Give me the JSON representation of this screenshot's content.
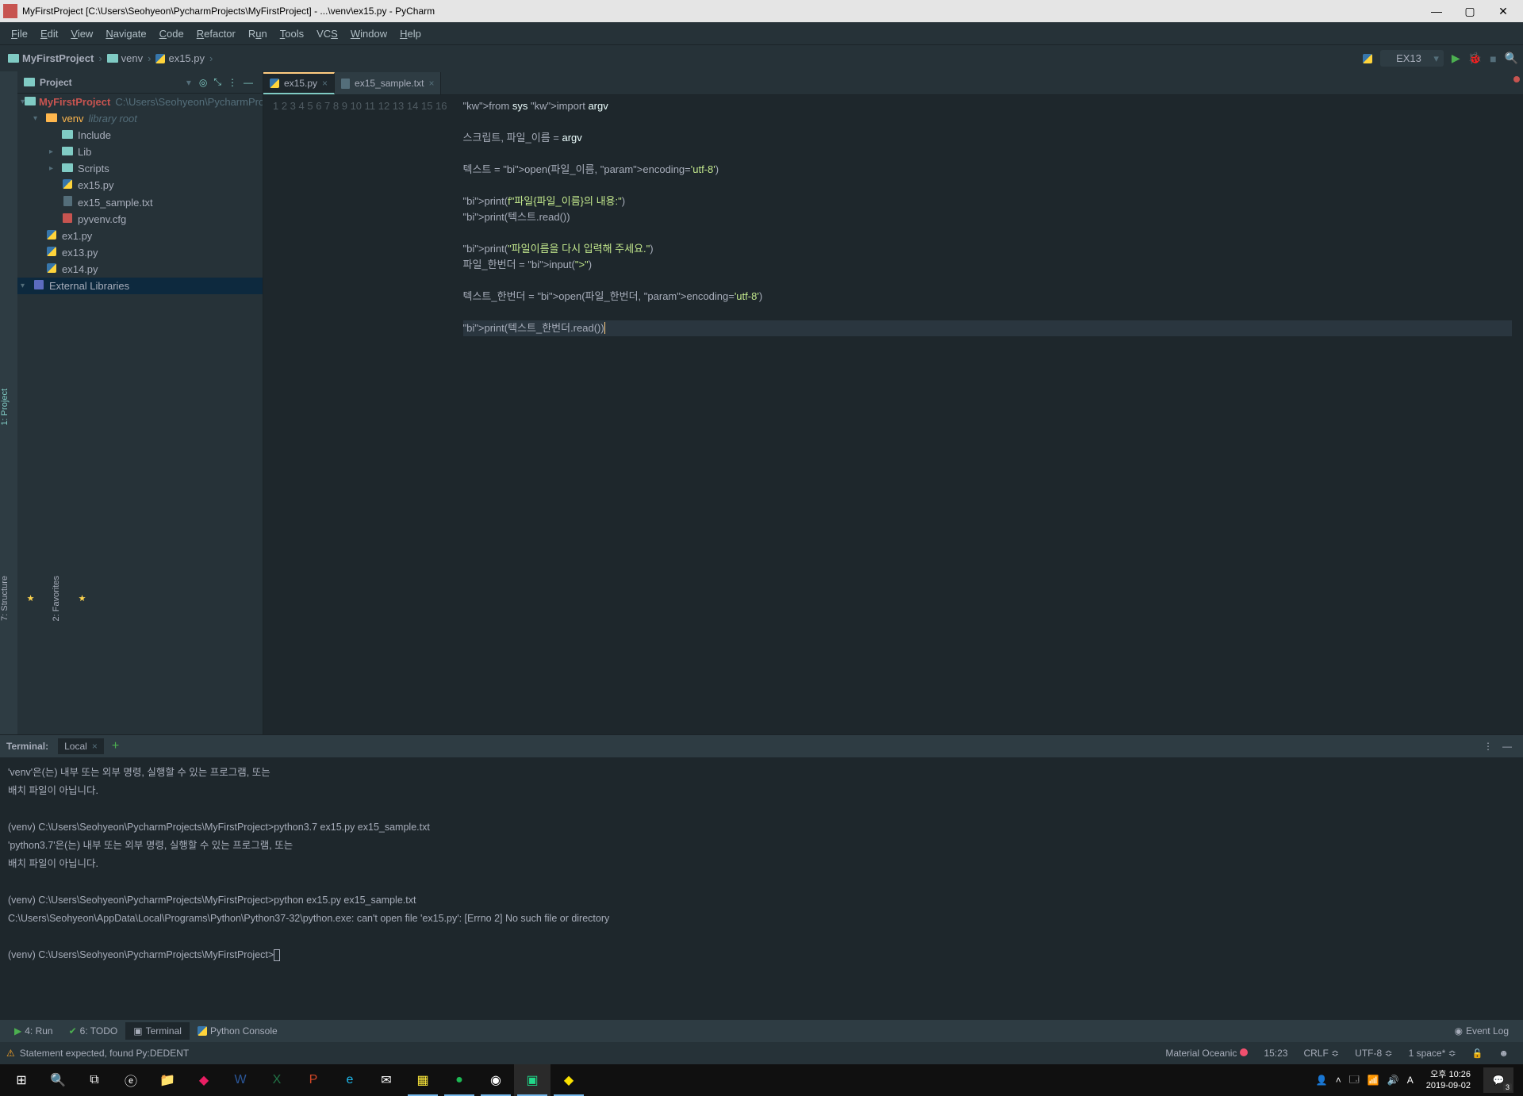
{
  "window": {
    "title": "MyFirstProject [C:\\Users\\Seohyeon\\PycharmProjects\\MyFirstProject] - ...\\venv\\ex15.py - PyCharm"
  },
  "menu": {
    "items": [
      "File",
      "Edit",
      "View",
      "Navigate",
      "Code",
      "Refactor",
      "Run",
      "Tools",
      "VCS",
      "Window",
      "Help"
    ]
  },
  "breadcrumb": {
    "project": "MyFirstProject",
    "parts": [
      "venv",
      "ex15.py"
    ]
  },
  "run_config": {
    "selected": "EX13"
  },
  "project_tool": {
    "title": "Project"
  },
  "tree": {
    "root": {
      "name": "MyFirstProject",
      "path": "C:\\Users\\Seohyeon\\PycharmProjects\\MyFirstProject"
    },
    "venv": {
      "name": "venv",
      "hint": "library root"
    },
    "nodes": [
      {
        "label": "Include",
        "kind": "dir"
      },
      {
        "label": "Lib",
        "kind": "dir"
      },
      {
        "label": "Scripts",
        "kind": "dir"
      },
      {
        "label": "ex15.py",
        "kind": "py"
      },
      {
        "label": "ex15_sample.txt",
        "kind": "txt"
      },
      {
        "label": "pyvenv.cfg",
        "kind": "cfg"
      },
      {
        "label": "ex1.py",
        "kind": "py"
      },
      {
        "label": "ex13.py",
        "kind": "py"
      },
      {
        "label": "ex14.py",
        "kind": "py"
      }
    ],
    "external": "External Libraries"
  },
  "tabs": [
    {
      "label": "ex15.py",
      "active": true,
      "kind": "py"
    },
    {
      "label": "ex15_sample.txt",
      "active": false,
      "kind": "txt"
    }
  ],
  "code": {
    "lines": [
      "from sys import argv",
      "",
      "스크립트, 파일_이름 = argv",
      "",
      "텍스트 = open(파일_이름, encoding='utf-8')",
      "",
      "print(f\"파일{파일_이름}의 내용:\")",
      "print(텍스트.read())",
      "",
      "print(\"파일이름을 다시 입력해 주세요.\")",
      "파일_한번더 = input(\">\")",
      "",
      "텍스트_한번더 = open(파일_한번더, encoding='utf-8')",
      "",
      "print(텍스트_한번더.read())",
      ""
    ],
    "line_count": 16,
    "current_line": 15
  },
  "terminal": {
    "title": "Terminal:",
    "tab": "Local",
    "output": "'venv'은(는) 내부 또는 외부 명령, 실행할 수 있는 프로그램, 또는\n배치 파일이 아닙니다.\n\n(venv) C:\\Users\\Seohyeon\\PycharmProjects\\MyFirstProject>python3.7 ex15.py ex15_sample.txt\n'python3.7'은(는) 내부 또는 외부 명령, 실행할 수 있는 프로그램, 또는\n배치 파일이 아닙니다.\n\n(venv) C:\\Users\\Seohyeon\\PycharmProjects\\MyFirstProject>python ex15.py ex15_sample.txt\nC:\\Users\\Seohyeon\\AppData\\Local\\Programs\\Python\\Python37-32\\python.exe: can't open file 'ex15.py': [Errno 2] No such file or directory\n\n(venv) C:\\Users\\Seohyeon\\PycharmProjects\\MyFirstProject>"
  },
  "bottom_tools": {
    "run": "4: Run",
    "todo": "6: TODO",
    "terminal": "Terminal",
    "console": "Python Console",
    "event_log": "Event Log"
  },
  "status": {
    "message": "Statement expected, found Py:DEDENT",
    "theme": "Material Oceanic",
    "pos": "15:23",
    "sep": "CRLF",
    "enc": "UTF-8",
    "indent": "1 space*"
  },
  "taskbar": {
    "time": "오후 10:26",
    "date": "2019-09-02",
    "notif_count": "3"
  },
  "sidebar_strip": {
    "project": "1: Project",
    "structure": "7: Structure",
    "favorites": "2: Favorites"
  }
}
